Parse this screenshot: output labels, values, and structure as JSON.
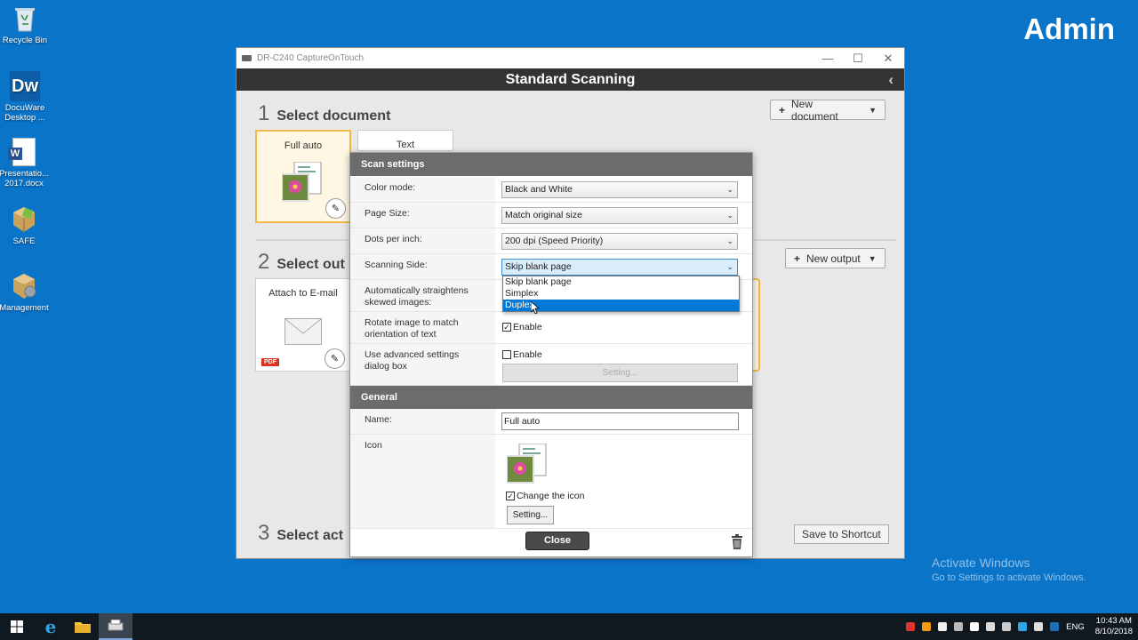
{
  "desktop": {
    "icons": [
      {
        "label": "Recycle Bin",
        "icon": "recycle-bin-icon"
      },
      {
        "label": "DocuWare Desktop ...",
        "icon": "docuware-icon",
        "glyph": "Dw"
      },
      {
        "label": "Presentatio... 2017.docx",
        "icon": "word-document-icon",
        "glyph": "W"
      },
      {
        "label": "SAFE",
        "icon": "safe-package-icon"
      },
      {
        "label": "Management",
        "icon": "management-package-icon"
      }
    ],
    "user_label": "Admin",
    "watermark": {
      "line1": "Activate Windows",
      "line2": "Go to Settings to activate Windows."
    }
  },
  "window": {
    "title": "DR-C240 CaptureOnTouch",
    "controls": {
      "minimize": "—",
      "maximize": "☐",
      "close": "✕"
    },
    "header": "Standard Scanning",
    "back_glyph": "‹"
  },
  "steps": [
    {
      "num": "1",
      "title": "Select document"
    },
    {
      "num": "2",
      "title": "Select out"
    },
    {
      "num": "3",
      "title": "Select act"
    }
  ],
  "buttons": {
    "new_document": "New document",
    "new_output": "New output",
    "save_shortcut": "Save to Shortcut",
    "plus": "+",
    "caret": "▼"
  },
  "cards": {
    "full_auto": "Full auto",
    "text": "Text",
    "attach_email": "Attach to E-mail",
    "pdf_badge": "PDF"
  },
  "scan_settings": {
    "heading": "Scan settings",
    "color_mode": {
      "label": "Color mode:",
      "value": "Black and White"
    },
    "page_size": {
      "label": "Page Size:",
      "value": "Match original size"
    },
    "dpi": {
      "label": "Dots per inch:",
      "value": "200 dpi (Speed Priority)"
    },
    "scanning_side": {
      "label": "Scanning Side:",
      "value": "Skip blank page",
      "options": [
        "Skip blank page",
        "Simplex",
        "Duplex"
      ],
      "highlighted": "Duplex"
    },
    "straighten": {
      "label": "Automatically straightens skewed images:"
    },
    "rotate": {
      "label": "Rotate image to match orientation of text",
      "checkbox": "Enable",
      "checked": true
    },
    "advanced": {
      "label": "Use advanced settings dialog box",
      "checkbox": "Enable",
      "checked": false,
      "button": "Setting..."
    }
  },
  "general": {
    "heading": "General",
    "name": {
      "label": "Name:",
      "value": "Full auto"
    },
    "icon": {
      "label": "Icon",
      "checkbox": "Change the icon",
      "checked": true,
      "button": "Setting..."
    }
  },
  "dialog_footer": {
    "close": "Close"
  },
  "taskbar": {
    "lang": "ENG",
    "time": "10:43 AM",
    "date": "8/10/2018"
  },
  "colors": {
    "desktop": "#0a74c9",
    "header": "#333333",
    "selected_card_border": "#f1b949",
    "dropdown_highlight": "#0078d7"
  }
}
